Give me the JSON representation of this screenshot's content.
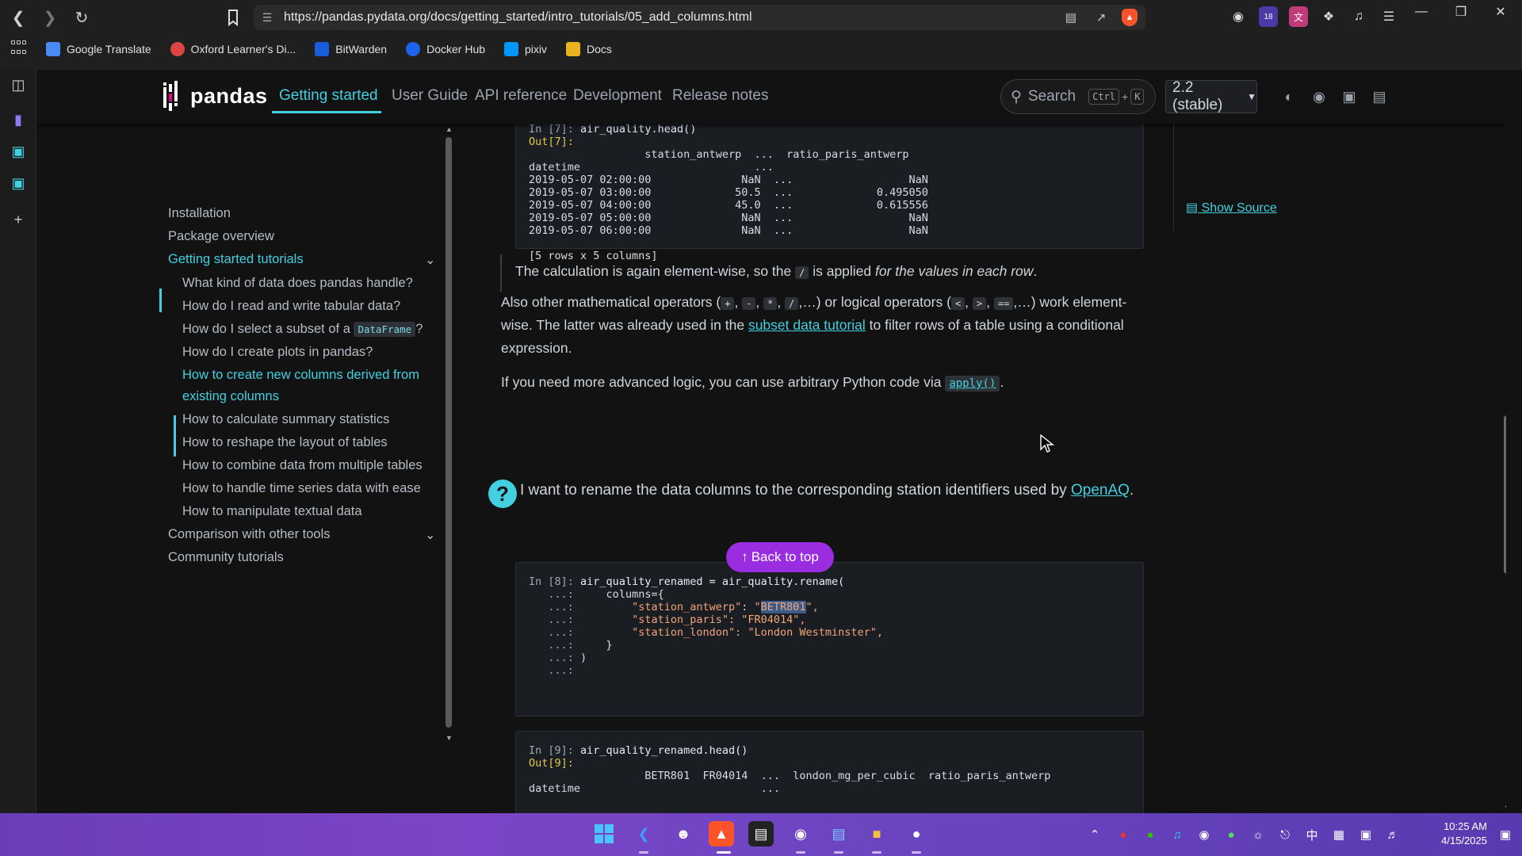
{
  "browser": {
    "url": "https://pandas.pydata.org/docs/getting_started/intro_tutorials/05_add_columns.html",
    "bookmarks": [
      "Google Translate",
      "Oxford Learner's Di...",
      "BitWarden",
      "Docker Hub",
      "pixiv",
      "Docs"
    ],
    "extension_badge": "18"
  },
  "header": {
    "logo": "pandas",
    "nav": [
      "Getting started",
      "User Guide",
      "API reference",
      "Development",
      "Release notes"
    ],
    "search_placeholder": "Search",
    "kbd_ctrl": "Ctrl",
    "kbd_plus": "+",
    "kbd_k": "K",
    "version": "2.2 (stable)"
  },
  "sidebar": {
    "items": [
      {
        "label": "Installation"
      },
      {
        "label": "Package overview"
      },
      {
        "label": "Getting started tutorials"
      },
      {
        "label": "What kind of data does pandas handle?"
      },
      {
        "label": "How do I read and write tabular data?"
      },
      {
        "label": "How do I select a subset of a",
        "code": "DataFrame",
        "suffix": "?"
      },
      {
        "label": "How do I create plots in pandas?"
      },
      {
        "label": "How to create new columns derived from"
      },
      {
        "label": "existing columns"
      },
      {
        "label": "How to calculate summary statistics"
      },
      {
        "label": "How to reshape the layout of tables"
      },
      {
        "label": "How to combine data from multiple tables"
      },
      {
        "label": "How to handle time series data with ease"
      },
      {
        "label": "How to manipulate textual data"
      },
      {
        "label": "Comparison with other tools"
      },
      {
        "label": "Community tutorials"
      }
    ]
  },
  "content": {
    "block7": {
      "in_prompt": "In [7]:",
      "in_code": "air_quality.head()",
      "out_prompt": "Out[7]:",
      "lines": [
        "                  station_antwerp  ...  ratio_paris_antwerp",
        "datetime                           ...",
        "2019-05-07 02:00:00              NaN  ...                  NaN",
        "2019-05-07 03:00:00             50.5  ...             0.495050",
        "2019-05-07 04:00:00             45.0  ...             0.615556",
        "2019-05-07 05:00:00              NaN  ...                  NaN",
        "2019-05-07 06:00:00              NaN  ...                  NaN",
        "",
        "[5 rows x 5 columns]"
      ]
    },
    "p1_a": "The calculation is again element-wise, so the ",
    "p1_code": "/",
    "p1_b": " is applied ",
    "p1_i": "for the values in each row",
    "p1_c": ".",
    "p2_a": "Also other mathematical operators (",
    "p2_ops": [
      "+",
      "-",
      "*",
      "/"
    ],
    "p2_b": ",…) or logical operators (",
    "p2_lops": [
      "<",
      ">",
      "=="
    ],
    "p2_c": ",…) work element-",
    "p2_line2_a": "wise. The latter was already used in the ",
    "p2_link": "subset data tutorial",
    "p2_line2_b": " to filter rows of a table using a conditional",
    "p2_line3": "expression.",
    "p3_a": "If you need more advanced logic, you can use arbitrary Python code via ",
    "p3_code": "apply()",
    "p3_b": ".",
    "question": "I want to rename the data columns to the corresponding station identifiers used by",
    "question_link": "OpenAQ",
    "question_end": ".",
    "block8": {
      "in_prompt": "In [8]:",
      "line1": "air_quality_renamed = air_quality.rename(",
      "cont": "   ...:",
      "l2": "    columns={",
      "l3_key": "\"station_antwerp\"",
      "l3_sep": ": ",
      "l3_q1": "\"",
      "l3_val": "BETR801",
      "l3_q2": "\",",
      "l4": "\"station_paris\": \"FR04014\",",
      "l5": "\"station_london\": \"London Westminster\",",
      "l6": "    }",
      "l7": ")"
    },
    "back_to_top": "Back to top",
    "block9": {
      "in_prompt": "In [9]:",
      "in_code": "air_quality_renamed.head()",
      "out_prompt": "Out[9]:",
      "header": "                  BETR801  FR04014  ...  london_mg_per_cubic  ratio_paris_antwerp",
      "datetime": "datetime                            ..."
    },
    "show_source": "Show Source"
  },
  "taskbar": {
    "time": "10:25 AM",
    "date": "4/15/2025",
    "ime": "中"
  }
}
